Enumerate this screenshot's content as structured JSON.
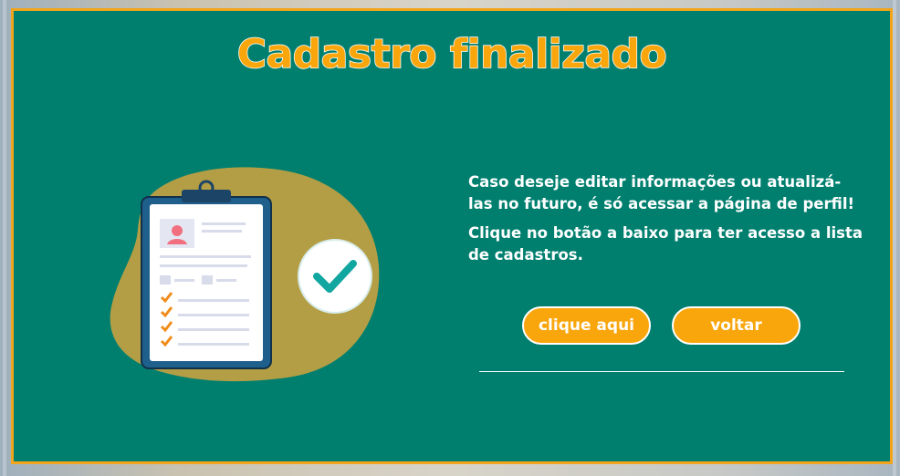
{
  "modal": {
    "title": "Cadastro finalizado",
    "message_line_1": "Caso deseje editar informações ou atualizá-las no futuro, é só acessar a página de perfil!",
    "message_line_2": "Clique no botão a baixo para ter acesso a lista de cadastros.",
    "buttons": {
      "clique_label": "clique aqui",
      "voltar_label": "voltar"
    }
  },
  "colors": {
    "modal_background": "#007f6f",
    "accent_orange": "#f9a60c",
    "blob": "#b49e45",
    "clipboard": "#1e5f8c"
  },
  "icons": {
    "illustration": "clipboard-checklist-icon",
    "check": "check-circle-icon",
    "avatar": "user-avatar-icon"
  }
}
